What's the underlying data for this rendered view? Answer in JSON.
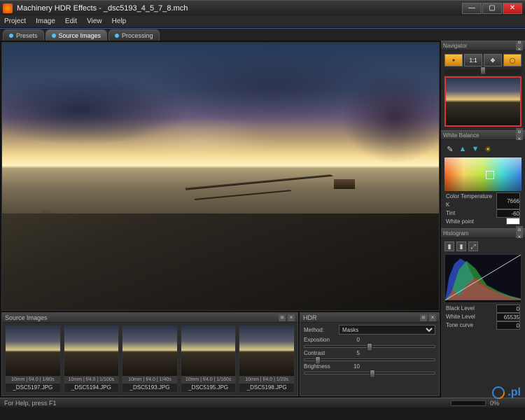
{
  "window": {
    "title": "Machinery HDR Effects - _dsc5193_4_5_7_8.mch"
  },
  "menu": [
    "Project",
    "Image",
    "Edit",
    "View",
    "Help"
  ],
  "tabs": [
    {
      "label": "Presets",
      "active": false
    },
    {
      "label": "Source Images",
      "active": true
    },
    {
      "label": "Processing",
      "active": false
    }
  ],
  "source_images": {
    "title": "Source Images",
    "thumbs": [
      {
        "meta": "10mm | f/4.0 | 1/80s",
        "name": "_DSC5197.JPG"
      },
      {
        "meta": "10mm | f/4.0 | 1/100s",
        "name": "_DSC5194.JPG"
      },
      {
        "meta": "10mm | f/4.0 | 1/40s",
        "name": "_DSC5193.JPG"
      },
      {
        "meta": "10mm | f/4.0 | 1/160s",
        "name": "_DSC5195.JPG"
      },
      {
        "meta": "10mm | f/4.0 | 1/20s",
        "name": "_DSC5198.JPG"
      }
    ]
  },
  "hdr": {
    "title": "HDR",
    "method_label": "Method:",
    "method_value": "Masks",
    "exposition_label": "Exposition",
    "exposition_value": "0",
    "contrast_label": "Contrast",
    "contrast_value": "5",
    "brightness_label": "Brightness",
    "brightness_value": "10"
  },
  "navigator": {
    "title": "Navigator",
    "ratio": "1:1"
  },
  "white_balance": {
    "title": "White Balance",
    "colortemp_label": "Color Temperature K",
    "colortemp_value": "7666",
    "tint_label": "Tint",
    "tint_value": "-60",
    "whitepoint_label": "White point"
  },
  "histogram": {
    "title": "Histogram",
    "black_label": "Black Level",
    "black_value": "0",
    "white_label": "White Level",
    "white_value": "65535",
    "tone_label": "Tone curve",
    "tone_value": "0"
  },
  "statusbar": {
    "help": "For Help, press F1",
    "progress": "0%"
  },
  "watermark": ".pl"
}
